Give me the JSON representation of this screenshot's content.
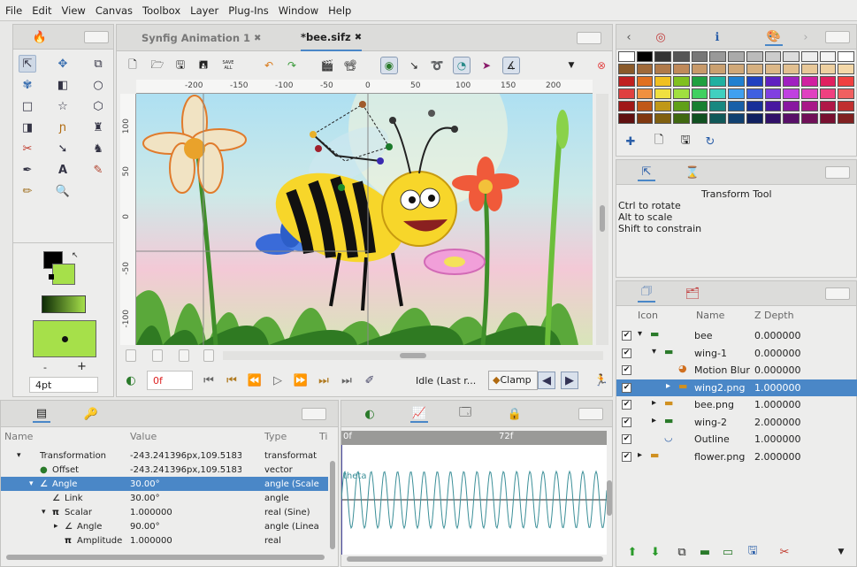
{
  "menu": [
    "File",
    "Edit",
    "View",
    "Canvas",
    "Toolbox",
    "Layer",
    "Plug-Ins",
    "Window",
    "Help"
  ],
  "tabs": [
    {
      "label": "Synfig Animation 1",
      "close": "✖"
    },
    {
      "label": "*bee.sifz",
      "close": "✖"
    }
  ],
  "toolbar": {
    "save_all_label": "SAVE ALL"
  },
  "ruler_h": [
    "-200",
    "-150",
    "-100",
    "-50",
    "0",
    "50",
    "100",
    "150",
    "200"
  ],
  "ruler_v": [
    "100",
    "50",
    "0",
    "-50",
    "-100"
  ],
  "toolbox": {
    "brush_size": "4pt",
    "minus": "-",
    "plus": "+"
  },
  "timebar": {
    "current_frame": "0f",
    "status": "Idle (Last r...",
    "clamp_label": "Clamp"
  },
  "tool_options": {
    "title": "Transform Tool",
    "lines": [
      "Ctrl to rotate",
      "Alt to scale",
      "Shift to constrain"
    ]
  },
  "layers": {
    "headers": {
      "icon": "Icon",
      "name": "Name",
      "zdepth": "Z Depth"
    },
    "rows": [
      {
        "name": "bee",
        "z": "0.000000",
        "expand": "▾",
        "indent": 0,
        "icon": "folder-icon"
      },
      {
        "name": "wing-1",
        "z": "0.000000",
        "expand": "▾",
        "indent": 1,
        "icon": "folder-icon"
      },
      {
        "name": "Motion Blur",
        "z": "0.000000",
        "expand": "",
        "indent": 2,
        "icon": "motion-blur-icon"
      },
      {
        "name": "wing2.png",
        "z": "1.000000",
        "expand": "▸",
        "indent": 2,
        "icon": "image-folder-icon",
        "selected": true
      },
      {
        "name": "bee.png",
        "z": "1.000000",
        "expand": "▸",
        "indent": 1,
        "icon": "image-folder-icon"
      },
      {
        "name": "wing-2",
        "z": "2.000000",
        "expand": "▸",
        "indent": 1,
        "icon": "folder-icon"
      },
      {
        "name": "Outline",
        "z": "1.000000",
        "expand": "",
        "indent": 1,
        "icon": "outline-icon"
      },
      {
        "name": "flower.png",
        "z": "2.000000",
        "expand": "▸",
        "indent": 0,
        "icon": "image-folder-icon"
      }
    ]
  },
  "params": {
    "headers": {
      "name": "Name",
      "value": "Value",
      "type": "Type",
      "ti": "Ti"
    },
    "rows": [
      {
        "name": "Transformation",
        "value": "-243.241396px,109.51838",
        "type": "transformat",
        "indent": 0,
        "expand": "▾"
      },
      {
        "name": "Offset",
        "value": "-243.241396px,109.51838",
        "type": "vector",
        "indent": 1,
        "expand": ""
      },
      {
        "name": "Angle",
        "value": "30.00°",
        "type": "angle (Scale",
        "indent": 1,
        "expand": "▾",
        "selected": true
      },
      {
        "name": "Link",
        "value": "30.00°",
        "type": "angle",
        "indent": 2,
        "expand": ""
      },
      {
        "name": "Scalar",
        "value": "1.000000",
        "type": "real (Sine)",
        "indent": 2,
        "expand": "▾"
      },
      {
        "name": "Angle",
        "value": "90.00°",
        "type": "angle (Linea",
        "indent": 3,
        "expand": "▸"
      },
      {
        "name": "Amplitude",
        "value": "1.000000",
        "type": "real",
        "indent": 3,
        "expand": ""
      }
    ]
  },
  "graph": {
    "start": "0f",
    "mark": "72f",
    "curve_label": "theta"
  },
  "colors": {
    "accent": "#4a87c7",
    "selection": "#4a87c7",
    "curve": "#3b8f98"
  }
}
